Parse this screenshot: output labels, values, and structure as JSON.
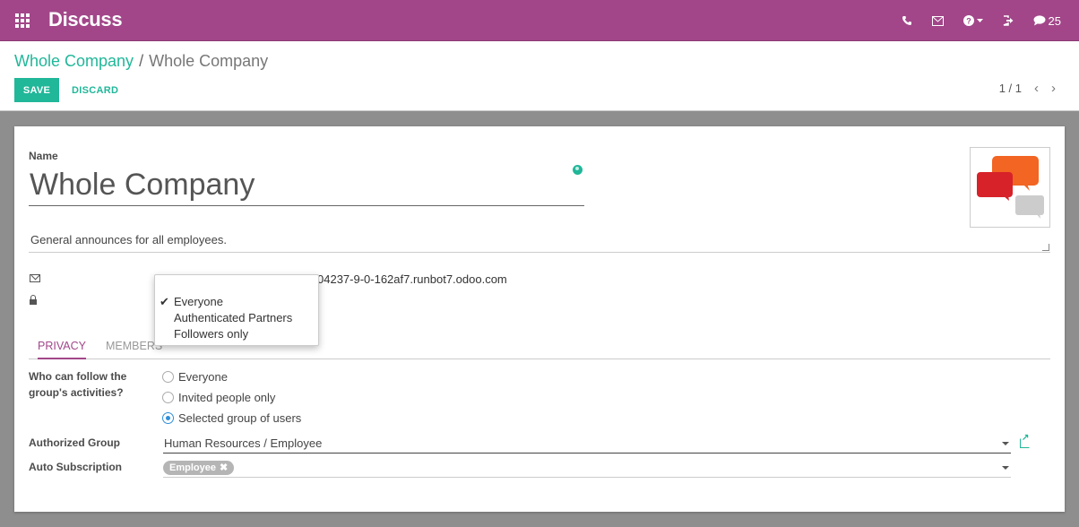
{
  "navbar": {
    "app_title": "Discuss",
    "messages_count": "25",
    "colors": {
      "background": "#a24689"
    }
  },
  "breadcrumb": {
    "parent": "Whole Company",
    "separator": "/",
    "current": "Whole Company"
  },
  "toolbar": {
    "save_label": "SAVE",
    "discard_label": "DISCARD"
  },
  "pager": {
    "value": "1 / 1"
  },
  "form": {
    "name_label": "Name",
    "name_value": "Whole Company",
    "description": "General announces for all employees.",
    "email_partial": "04237-9-0-162af7.runbot7.odoo.com",
    "tabs": [
      {
        "label": "PRIVACY",
        "active": true
      },
      {
        "label": "MEMBERS",
        "active": false
      }
    ],
    "follow_label_line1": "Who can follow the",
    "follow_label_line2": "group's activities?",
    "follow_options": [
      {
        "label": "Everyone",
        "selected": false
      },
      {
        "label": "Invited people only",
        "selected": false
      },
      {
        "label": "Selected group of users",
        "selected": true
      }
    ],
    "authorized_group_label": "Authorized Group",
    "authorized_group_value": "Human Resources / Employee",
    "auto_subscription_label": "Auto Subscription",
    "auto_subscription_tags": [
      "Employee"
    ]
  },
  "dropdown": {
    "items": [
      {
        "label": "Everyone",
        "checked": true
      },
      {
        "label": "Authenticated Partners",
        "checked": false
      },
      {
        "label": "Followers only",
        "checked": false
      }
    ]
  },
  "colors": {
    "accent": "#21b799",
    "primary": "#a24689",
    "radio_selected": "#2f8fd8"
  }
}
